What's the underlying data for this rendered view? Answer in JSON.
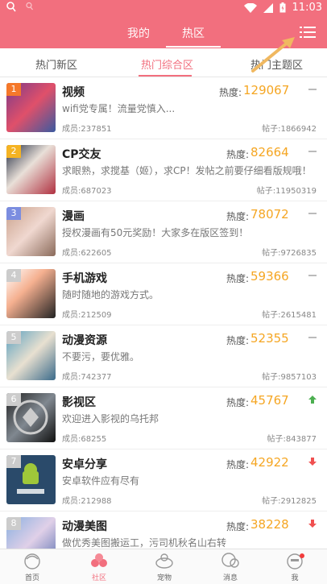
{
  "status": {
    "time": "11:03"
  },
  "header": {
    "tab_mine": "我的",
    "tab_hot": "热区"
  },
  "subtabs": [
    "热门新区",
    "热门综合区",
    "热门主题区"
  ],
  "labels": {
    "heat": "热度:"
  },
  "rows": [
    {
      "rank": "1",
      "rank_color": "#f5782a",
      "title": "视频",
      "heat": "129067",
      "desc": "wifi党专属！流量党慎入...",
      "members": "成员:237851",
      "posts": "帖子:1866942",
      "trend": "flat"
    },
    {
      "rank": "2",
      "rank_color": "#f5b323",
      "title": "CP交友",
      "heat": "82664",
      "desc": "求眼熟，求搅基（姬），求CP！发帖之前要仔细看版规哦！",
      "members": "成员:687023",
      "posts": "帖子:11950319",
      "trend": "flat"
    },
    {
      "rank": "3",
      "rank_color": "#7b8de0",
      "title": "漫画",
      "heat": "78072",
      "desc": "授权漫画有50元奖励！大家多在版区签到！",
      "members": "成员:622605",
      "posts": "帖子:9726835",
      "trend": "flat"
    },
    {
      "rank": "4",
      "rank_color": "#cccccc",
      "title": "手机游戏",
      "heat": "59366",
      "desc": "随时随地的游戏方式。",
      "members": "成员:212509",
      "posts": "帖子:2615481",
      "trend": "flat"
    },
    {
      "rank": "5",
      "rank_color": "#cccccc",
      "title": "动漫资源",
      "heat": "52355",
      "desc": "不要污，要优雅。",
      "members": "成员:742377",
      "posts": "帖子:9857103",
      "trend": "flat"
    },
    {
      "rank": "6",
      "rank_color": "#cccccc",
      "title": "影视区",
      "heat": "45767",
      "desc": "欢迎进入影视的乌托邦",
      "members": "成员:68255",
      "posts": "帖子:843877",
      "trend": "up"
    },
    {
      "rank": "7",
      "rank_color": "#cccccc",
      "title": "安卓分享",
      "heat": "42922",
      "desc": "安卓软件应有尽有",
      "members": "成员:212988",
      "posts": "帖子:2912825",
      "trend": "down"
    },
    {
      "rank": "8",
      "rank_color": "#cccccc",
      "title": "动漫美图",
      "heat": "38228",
      "desc": "做优秀美图搬运工，污司机秋名山右转",
      "members": "",
      "posts": "",
      "trend": "down"
    }
  ],
  "bottom_nav": [
    {
      "label": "首页",
      "icon": "home-icon"
    },
    {
      "label": "社区",
      "icon": "community-icon"
    },
    {
      "label": "宠物",
      "icon": "pet-icon"
    },
    {
      "label": "消息",
      "icon": "message-icon"
    },
    {
      "label": "我",
      "icon": "profile-icon"
    }
  ],
  "colors": {
    "brand": "#f26f7e",
    "heat": "#f5a623",
    "up": "#4caf50",
    "down": "#f05050"
  }
}
